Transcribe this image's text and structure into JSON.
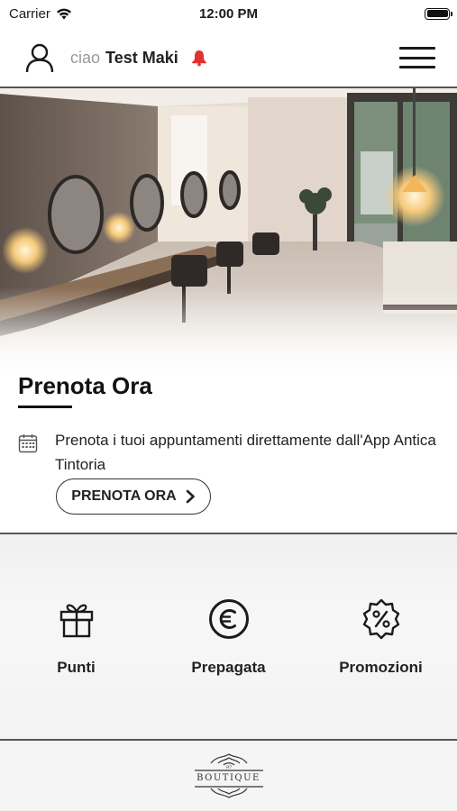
{
  "status_bar": {
    "carrier": "Carrier",
    "time": "12:00 PM"
  },
  "header": {
    "greeting": "ciao",
    "user_name": "Test Maki"
  },
  "booking": {
    "title": "Prenota Ora",
    "description": "Prenota i tuoi appuntamenti direttamente dall'App Antica Tintoria",
    "button_label": "PRENOTA ORA"
  },
  "actions": [
    {
      "label": "Punti",
      "icon": "gift-icon"
    },
    {
      "label": "Prepagata",
      "icon": "euro-icon"
    },
    {
      "label": "Promozioni",
      "icon": "discount-badge-icon"
    }
  ],
  "footer": {
    "logo_text": "BOUTIQUE",
    "logo_small": "97"
  },
  "colors": {
    "accent": "#e03131",
    "text": "#1a1a1a",
    "divider": "#555555"
  }
}
